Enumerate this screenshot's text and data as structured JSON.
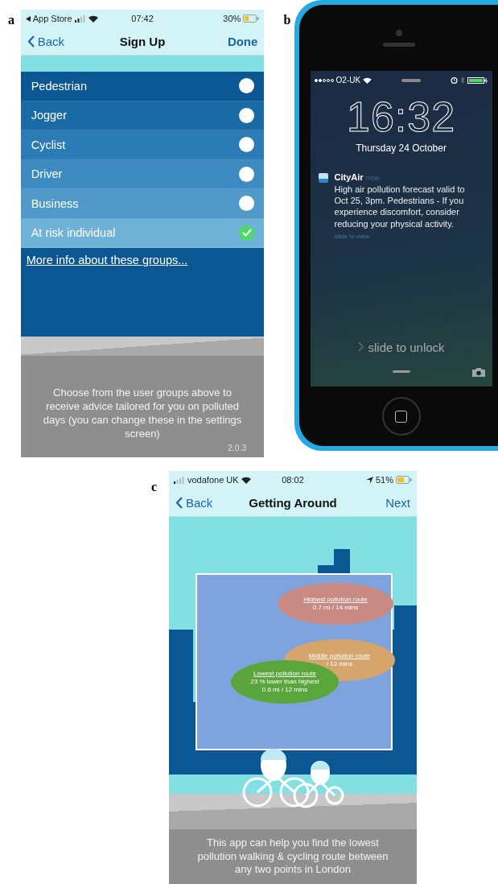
{
  "panel_a": {
    "label": "a",
    "status_bar": {
      "carrier": "App Store",
      "time": "07:42",
      "battery": "30%"
    },
    "nav": {
      "back": "Back",
      "title": "Sign Up",
      "action": "Done"
    },
    "groups": [
      {
        "label": "Pedestrian",
        "checked": false
      },
      {
        "label": "Jogger",
        "checked": false
      },
      {
        "label": "Cyclist",
        "checked": false
      },
      {
        "label": "Driver",
        "checked": false
      },
      {
        "label": "Business",
        "checked": false
      },
      {
        "label": "At risk individual",
        "checked": true
      }
    ],
    "link": "More info about these groups...",
    "info": "Choose from the user groups above to receive advice tailored for you on polluted days (you can change these in the settings screen)",
    "version": "2.0.3"
  },
  "panel_b": {
    "label": "b",
    "status_bar": {
      "carrier": "O2-UK"
    },
    "time": "16:32",
    "date": "Thursday 24 October",
    "notification": {
      "app": "CityAir",
      "when": "now",
      "body": "High air pollution forecast valid to Oct 25, 3pm. Pedestrians - If you experience discomfort, consider reducing your physical activity.",
      "hint": "slide to view"
    },
    "unlock": "slide to unlock"
  },
  "panel_c": {
    "label": "c",
    "status_bar": {
      "carrier": "vodafone UK",
      "time": "08:02",
      "battery": "51%"
    },
    "nav": {
      "back": "Back",
      "title": "Getting Around",
      "action": "Next"
    },
    "routes": [
      {
        "kind": "highest",
        "title": "Highest pollution route",
        "lines": [
          "0.7 mi / 14 mins"
        ],
        "color": "#c98a84"
      },
      {
        "kind": "middle",
        "title": "Middle pollution route",
        "lines": [
          "/ 12 mins"
        ],
        "color": "#d6a56c"
      },
      {
        "kind": "lowest",
        "title": "Lowest pollution route",
        "lines": [
          "23 % lower than highest",
          "0.6 mi / 12 mins"
        ],
        "color": "#5aa63c"
      }
    ],
    "info": "This app can help you find the lowest pollution walking & cycling route between any two points in London"
  }
}
